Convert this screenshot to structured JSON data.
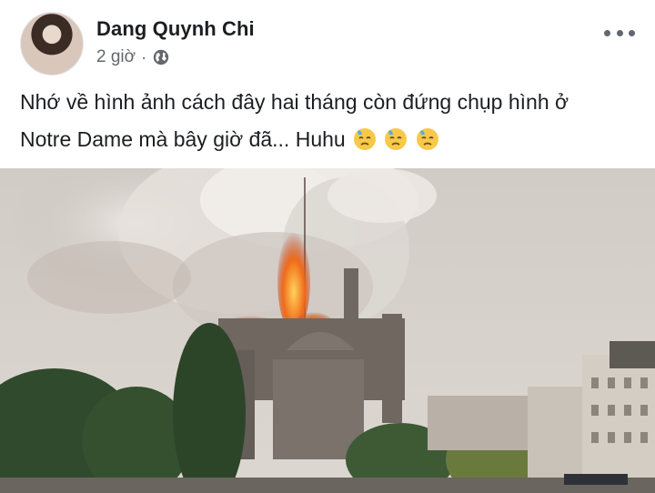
{
  "post": {
    "author": "Dang Quynh Chi",
    "time": "2 giờ",
    "separator": "·",
    "privacy_icon": "globe-icon",
    "more_icon": "more-horizontal-icon",
    "text_line1": "Nhớ về hình ảnh cách đây hai tháng còn đứng chụp hình ở",
    "text_line2": "Notre Dame mà bây giờ đã... Huhu",
    "emoji_icon": "downcast-face-with-sweat-icon",
    "emoji_count": 3
  },
  "colors": {
    "name": "#1c1e21",
    "meta": "#65676b",
    "emoji_yellow": "#f7c948",
    "emoji_sweat": "#5aa7e8"
  }
}
